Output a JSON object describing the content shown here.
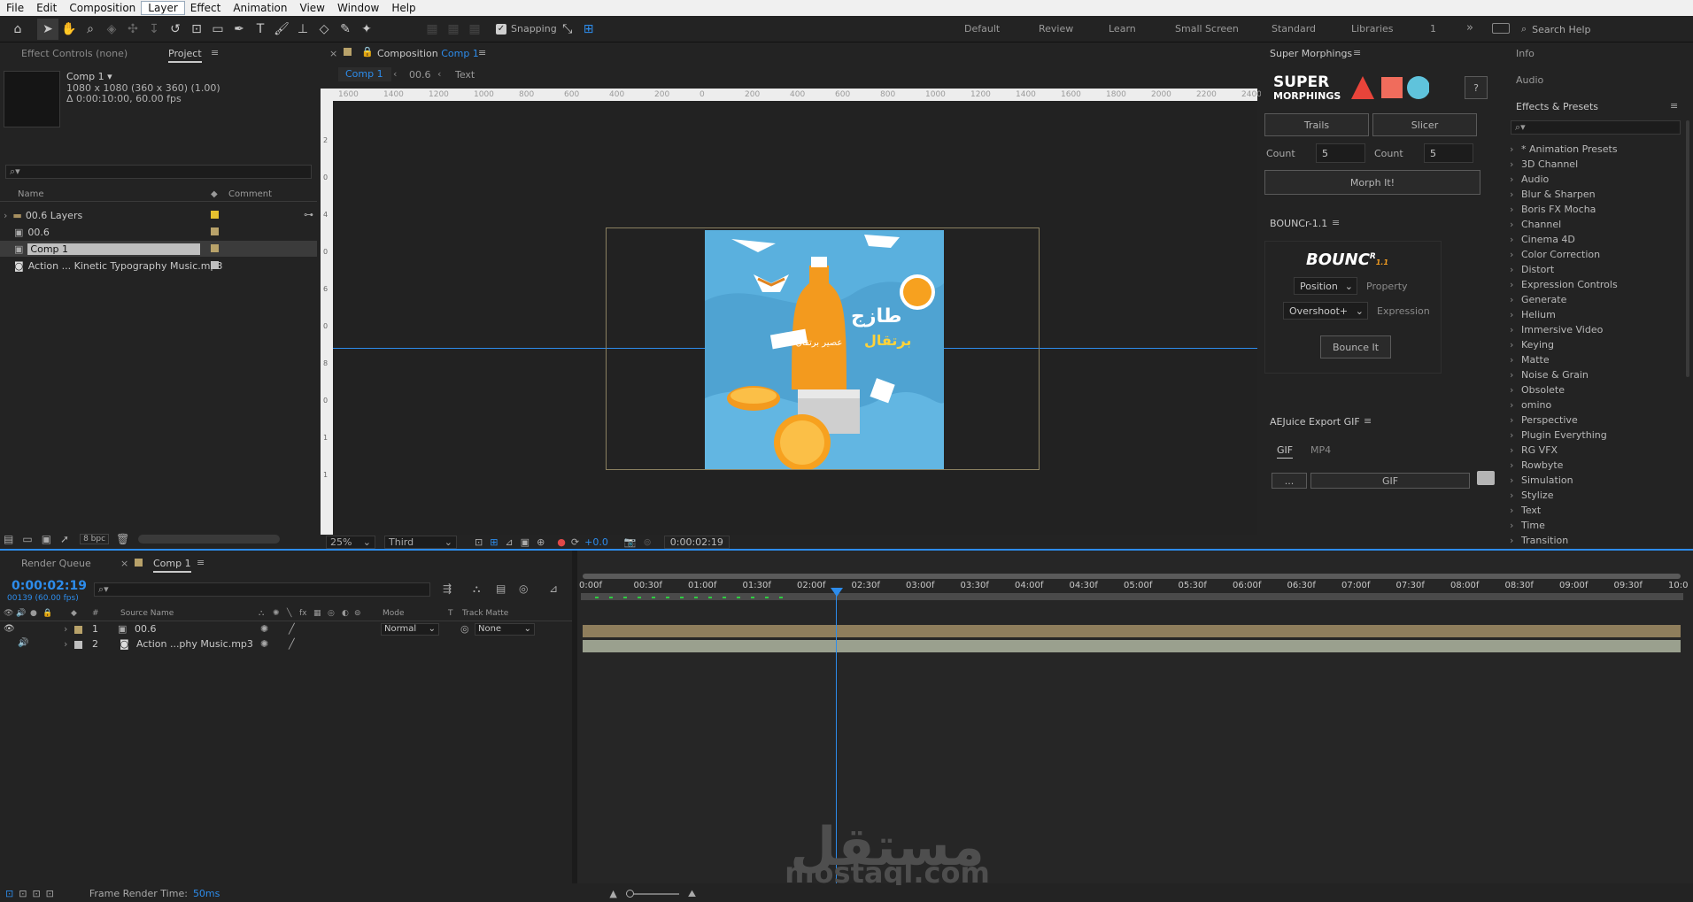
{
  "menu": [
    "File",
    "Edit",
    "Composition",
    "Layer",
    "Effect",
    "Animation",
    "View",
    "Window",
    "Help"
  ],
  "toolbar": {
    "snapping": "Snapping"
  },
  "workspaces": [
    "Default",
    "Review",
    "Learn",
    "Small Screen",
    "Standard",
    "Libraries",
    "1"
  ],
  "search_help": "Search Help",
  "left_panel": {
    "tab_effect_controls": "Effect Controls (none)",
    "tab_project": "Project",
    "comp_name": "Comp 1 ▾",
    "comp_info1": "1080 x 1080  (360 x 360) (1.00)",
    "comp_info2": "Δ 0:00:10:00, 60.00 fps",
    "col_name": "Name",
    "col_comment": "Comment",
    "items": [
      {
        "name": "00.6 Layers",
        "color": "#e6c12f"
      },
      {
        "name": "00.6",
        "color": "#b8a26a"
      },
      {
        "name": "Comp 1",
        "color": "#b8a26a"
      },
      {
        "name": "Action ... Kinetic Typography Music.mp3",
        "color": "#bfbfbf"
      }
    ],
    "bpc": "8 bpc"
  },
  "viewer": {
    "tab_label": "Composition",
    "tab_comp": "Comp 1",
    "crumb1": "Comp 1",
    "crumb2": "00.6",
    "crumb3": "Text",
    "ruler_labels": [
      "1600",
      "1400",
      "1200",
      "1000",
      "800",
      "600",
      "400",
      "200",
      "0",
      "200",
      "400",
      "600",
      "800",
      "1000",
      "1200",
      "1400",
      "1600",
      "1800",
      "2000",
      "2200",
      "2400"
    ],
    "vruler_labels": [
      "2",
      "0",
      "4",
      "0",
      "6",
      "0",
      "8",
      "0",
      "1",
      "1"
    ],
    "zoom": "25%",
    "view": "Third",
    "exposure": "+0.0",
    "timecode": "0:00:02:19",
    "artwork": {
      "arabic1": "طازج",
      "arabic2": "برتقال",
      "bottle_label": "عصير برتقال"
    }
  },
  "super_morphings": {
    "title": "Super Morphings",
    "logo1": "SUPER",
    "logo2": "MORPHINGS",
    "help": "?",
    "trails": "Trails",
    "slicer": "Slicer",
    "count_label": "Count",
    "count1": "5",
    "count2": "5",
    "morph": "Morph It!"
  },
  "bouncr": {
    "title": "BOUNCr-1.1",
    "logo": "BOUNC",
    "logo_sup": "R",
    "logo_ver": "1.1",
    "position": "Position",
    "property": "Property",
    "overshoot": "Overshoot+",
    "expression": "Expression",
    "bounce": "Bounce It"
  },
  "aejuice": {
    "title": "AEJuice Export GIF",
    "tab_gif": "GIF",
    "tab_mp4": "MP4",
    "dots": "...",
    "gif_btn": "GIF"
  },
  "right_panel": {
    "info": "Info",
    "audio": "Audio",
    "effects": "Effects & Presets",
    "effects_list": [
      "* Animation Presets",
      "3D Channel",
      "Audio",
      "Blur & Sharpen",
      "Boris FX Mocha",
      "Channel",
      "Cinema 4D",
      "Color Correction",
      "Distort",
      "Expression Controls",
      "Generate",
      "Helium",
      "Immersive Video",
      "Keying",
      "Matte",
      "Noise & Grain",
      "Obsolete",
      "omino",
      "Perspective",
      "Plugin Everything",
      "RG VFX",
      "Rowbyte",
      "Simulation",
      "Stylize",
      "Text",
      "Time",
      "Transition"
    ]
  },
  "timeline": {
    "tab_render": "Render Queue",
    "tab_comp": "Comp 1",
    "timecode": "0:00:02:19",
    "frames": "00139 (60.00 fps)",
    "col_hash": "#",
    "col_source": "Source Name",
    "col_mode": "Mode",
    "col_t": "T",
    "col_matte": "Track Matte",
    "layers": [
      {
        "num": "1",
        "name": "00.6",
        "mode": "Normal",
        "matte": "None",
        "color": "#b8a26a"
      },
      {
        "num": "2",
        "name": "Action ...phy Music.mp3",
        "color": "#bfbfbf"
      }
    ],
    "ruler": [
      "0:00f",
      "00:30f",
      "01:00f",
      "01:30f",
      "02:00f",
      "02:30f",
      "03:00f",
      "03:30f",
      "04:00f",
      "04:30f",
      "05:00f",
      "05:30f",
      "06:00f",
      "06:30f",
      "07:00f",
      "07:30f",
      "08:00f",
      "08:30f",
      "09:00f",
      "09:30f",
      "10:0"
    ],
    "render_time_label": "Frame Render Time:",
    "render_time": "50ms"
  },
  "watermark": {
    "arabic": "مستقل",
    "latin": "mostaql.com"
  }
}
